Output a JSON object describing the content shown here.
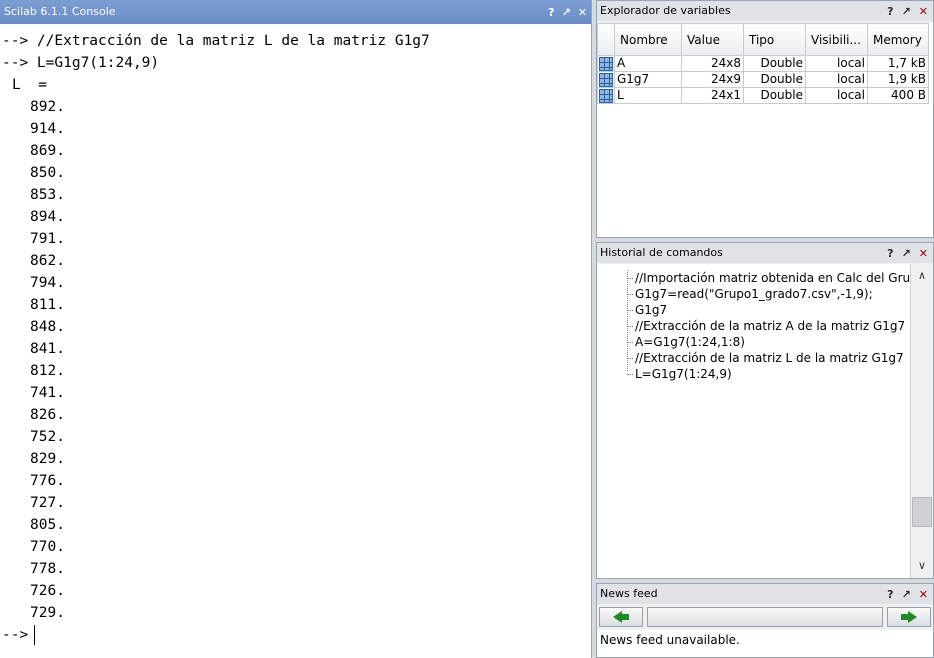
{
  "console": {
    "title": "Scilab 6.1.1 Console",
    "commands": [
      "--> //Extracción de la matriz L de la matriz G1g7",
      "--> L=G1g7(1:24,9)"
    ],
    "result_header": "L  =",
    "values": [
      "892.",
      "914.",
      "869.",
      "850.",
      "853.",
      "894.",
      "791.",
      "862.",
      "794.",
      "811.",
      "848.",
      "841.",
      "812.",
      "741.",
      "826.",
      "752.",
      "829.",
      "776.",
      "727.",
      "805.",
      "770.",
      "778.",
      "726.",
      "729."
    ],
    "prompt": "-->"
  },
  "dock_buttons": {
    "help": "?",
    "undock": "↗",
    "close": "✕"
  },
  "variable_browser": {
    "title": "Explorador de variables",
    "columns": [
      "Nombre",
      "Value",
      "Tipo",
      "Visibili...",
      "Memory"
    ],
    "rows": [
      {
        "name": "A",
        "value": "24x8",
        "type": "Double",
        "visibility": "local",
        "memory": "1,7 kB"
      },
      {
        "name": "G1g7",
        "value": "24x9",
        "type": "Double",
        "visibility": "local",
        "memory": "1,9 kB"
      },
      {
        "name": "L",
        "value": "24x1",
        "type": "Double",
        "visibility": "local",
        "memory": "400 B"
      }
    ]
  },
  "history": {
    "title": "Historial de comandos",
    "items": [
      "//Importación matriz obtenida en Calc del Grupo",
      "G1g7=read(\"Grupo1_grado7.csv\",-1,9);",
      "G1g7",
      "//Extracción de la matriz A de la matriz G1g7",
      "A=G1g7(1:24,1:8)",
      "//Extracción de la matriz L de la matriz G1g7",
      "L=G1g7(1:24,9)"
    ]
  },
  "news_feed": {
    "title": "News feed",
    "message": "News feed unavailable."
  }
}
